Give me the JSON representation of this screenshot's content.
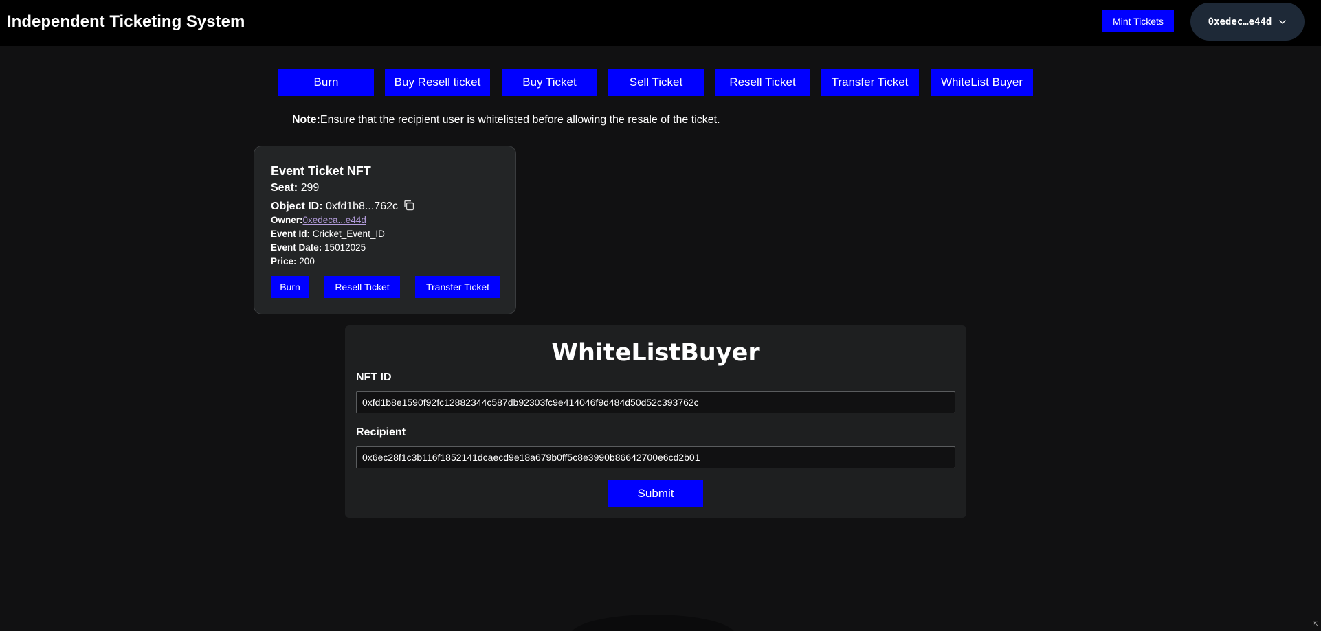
{
  "header": {
    "title": "Independent Ticketing System",
    "mint_label": "Mint Tickets",
    "wallet_label": "0xedec…e44d"
  },
  "nav": [
    {
      "label": "Burn"
    },
    {
      "label": "Buy Resell ticket"
    },
    {
      "label": "Buy Ticket"
    },
    {
      "label": "Sell Ticket"
    },
    {
      "label": "Resell Ticket"
    },
    {
      "label": "Transfer Ticket"
    },
    {
      "label": "WhiteList Buyer"
    }
  ],
  "note": {
    "prefix": "Note:",
    "text": "Ensure that the recipient user is whitelisted before allowing the resale of the ticket."
  },
  "card": {
    "title": "Event Ticket NFT",
    "seat_label": "Seat:",
    "seat_value": "299",
    "object_id_label": "Object ID:",
    "object_id_value": "0xfd1b8...762c",
    "owner_label": "Owner:",
    "owner_value": "0xedeca...e44d",
    "event_id_label": "Event Id:",
    "event_id_value": "Cricket_Event_ID",
    "event_date_label": "Event Date:",
    "event_date_value": "15012025",
    "price_label": "Price:",
    "price_value": "200",
    "buttons": {
      "burn": "Burn",
      "resell": "Resell Ticket",
      "transfer": "Transfer Ticket"
    }
  },
  "form": {
    "title": "WhiteListBuyer",
    "nft_label": "NFT ID",
    "nft_value": "0xfd1b8e1590f92fc12882344c587db92303fc9e414046f9d484d50d52c393762c",
    "recipient_label": "Recipient",
    "recipient_value": "0x6ec28f1c3b116f1852141dcaecd9e18a679b0ff5c8e3990b86642700e6cd2b01",
    "submit_label": "Submit"
  },
  "colors": {
    "accent": "#0000ff",
    "background": "#111112",
    "header": "#000000",
    "card": "#232526",
    "panel": "#1e1f20",
    "link": "#b39ddb"
  },
  "icons": {
    "copy": "copy-icon",
    "wallet_chevron": "chevron-down-icon"
  }
}
